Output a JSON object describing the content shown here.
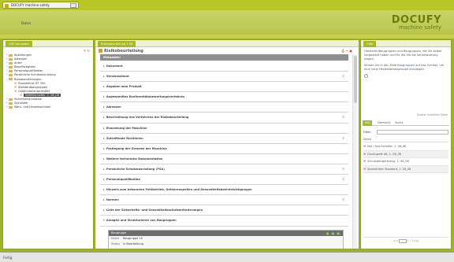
{
  "window": {
    "title": "DOCUFY machine safety"
  },
  "header": {
    "menu_item": "Datei",
    "logo_big": "DOCUFY",
    "logo_small": "machine safety"
  },
  "left_panel": {
    "tab": "CRS Navigator",
    "tree": [
      {
        "label": "Abbildungen",
        "indent": 0,
        "type": "folder"
      },
      {
        "label": "Adressen",
        "indent": 0,
        "type": "folder"
      },
      {
        "label": "Anker",
        "indent": 0,
        "type": "folder"
      },
      {
        "label": "Begriffsregister",
        "indent": 0,
        "type": "folder"
      },
      {
        "label": "Personalqualifikation",
        "indent": 0,
        "type": "folder"
      },
      {
        "label": "Persönliche Schutzausrüstung",
        "indent": 0,
        "type": "folder"
      },
      {
        "label": "Risikobeurteilungen",
        "indent": 0,
        "type": "folder"
      },
      {
        "label": "Produktlinie DT 350",
        "indent": 1,
        "type": "wrench"
      },
      {
        "label": "Standardbaugruppen",
        "indent": 1,
        "type": "wrench"
      },
      {
        "label": "Gefahrstellenwerkstatt",
        "indent": 1,
        "type": "wrench"
      },
      {
        "label": "Notfallschalter, 1. 06_08",
        "indent": 2,
        "type": "selected"
      },
      {
        "label": "Sicherheitshinweise",
        "indent": 0,
        "type": "folder"
      },
      {
        "label": "Sinnbilder",
        "indent": 0,
        "type": "folder"
      },
      {
        "label": "Warn- und Hinweisschilder",
        "indent": 0,
        "type": "folder"
      }
    ]
  },
  "center_panel": {
    "tab": "Risikobeurteilung 1.06",
    "title": "Risikobeurteilung",
    "sections_header": "Metadaten",
    "sections": [
      {
        "label": "Dokument",
        "search": false
      },
      {
        "label": "Versionsstand",
        "search": true
      },
      {
        "label": "Angaben zum Produkt",
        "search": false
      },
      {
        "label": "Angewandtes Konformitätsbewertungsverfahren",
        "search": false
      },
      {
        "label": "Adressen",
        "search": false
      },
      {
        "label": "Beschreibung des Verfahrens der Risikobeurteilung",
        "search": true
      },
      {
        "label": "Einordnung der Maschine",
        "search": false
      },
      {
        "label": "Zutreffende Richtlinien",
        "search": true
      },
      {
        "label": "Festlegung der Grenzen der Maschine",
        "search": false
      },
      {
        "label": "Weitere technische Dokumentation",
        "search": false
      },
      {
        "label": "Persönliche Schutzausrüstung (PSA)",
        "search": true
      },
      {
        "label": "Personalqualifikation",
        "search": true
      },
      {
        "label": "Hinweis zum bekannten Fehlbetrieb, Gefahrenquellen und Gesundheitsbeeinträchtigungen",
        "search": false
      },
      {
        "label": "Normen",
        "search": true
      },
      {
        "label": "Liste der Sicherheits- und Gesundheitsschutzanforderungen",
        "search": false
      },
      {
        "label": "Anlagen und Strukturieren von Baugruppen",
        "search": false
      }
    ],
    "sub_box": {
      "header": "Baugruppe",
      "rows": [
        {
          "key": "Name",
          "value": "Baugruppe 10"
        },
        {
          "key": "Status",
          "value": "in Bearbeitung"
        }
      ]
    }
  },
  "right_panel": {
    "tab": "Hilfe",
    "info_p1": "Hersteller/Baugruppen und Baugruppen, die Sie selbst hergestellt haben und für die Sie die Verantwortung tragen.",
    "info_p2_pre": "Klicken Sie in der Zeile ",
    "info_p2_link": "Baugruppen",
    "info_p2_post": " auf das Symbol, um eine neue Herstellerbaugruppe anzulegen.",
    "info_foot": "Zuletzt erstellten Datei",
    "tabs": [
      "Info",
      "Übersicht",
      "Suche"
    ],
    "filter_label": "Filter:",
    "list_header": "Name",
    "items": [
      "Not / Aus-Schalter, 1. 06_08",
      "Druckgerät AK, 1. 06_08",
      "Schneidenwerkzeug, 1. 06_08",
      "Spannfutter Standard, 1. 06_08"
    ],
    "pager_text": "1 / 1"
  },
  "statusbar": {
    "text": "Fertig"
  }
}
